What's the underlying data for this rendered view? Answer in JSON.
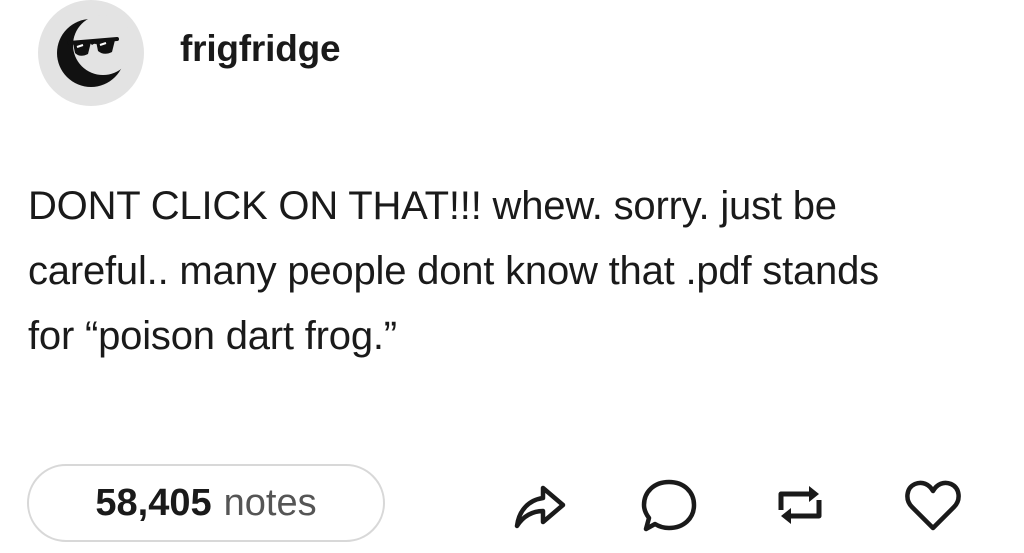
{
  "post": {
    "username": "frigfridge",
    "avatar_icon": "sunglasses-moon-icon",
    "body_lines": [
      "DONT CLICK ON THAT!!! whew. sorry. just be",
      "careful.. many people dont know that .pdf stands",
      "for “poison dart frog.”"
    ]
  },
  "footer": {
    "notes_count": "58,405",
    "notes_label": "notes",
    "actions": [
      {
        "icon": "share-icon"
      },
      {
        "icon": "reply-icon"
      },
      {
        "icon": "reblog-icon"
      },
      {
        "icon": "like-icon"
      }
    ]
  },
  "colors": {
    "text": "#1a1a1a",
    "muted": "#555555",
    "avatar_bg": "#e3e3e3",
    "pill_border": "#d8d8d8"
  }
}
